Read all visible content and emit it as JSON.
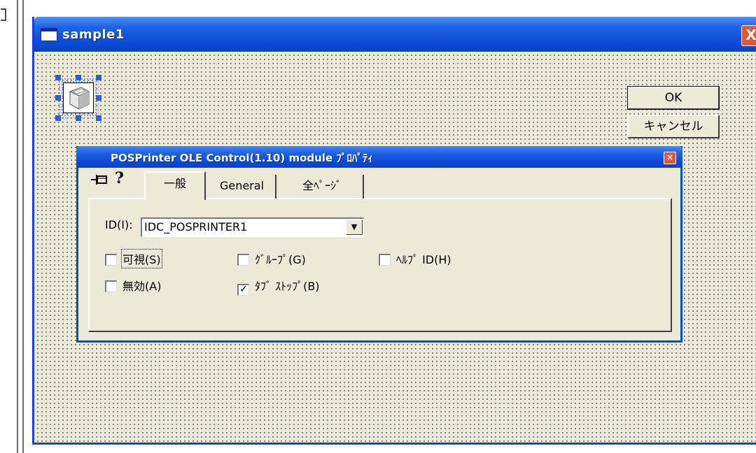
{
  "form": {
    "title": "sample1",
    "ok_label": "OK",
    "cancel_label": "キャンセル",
    "close_glyph": "X"
  },
  "dialog": {
    "title": "POSPrinter OLE Control(1.10) module ﾌﾟﾛﾊﾟﾃｨ",
    "close_glyph": "×",
    "help_glyph": "?",
    "tabs": [
      {
        "label": "一般",
        "active": true
      },
      {
        "label": "General",
        "active": false
      },
      {
        "label": "全ﾍﾟｰｼﾞ",
        "active": false
      }
    ],
    "id_label": "ID(I):",
    "id_value": "IDC_POSPRINTER1",
    "checkboxes": {
      "visible": {
        "label": "可視(S)",
        "checked": false
      },
      "group": {
        "label": "ｸﾞﾙｰﾌﾟ(G)",
        "checked": false
      },
      "helpid": {
        "label": "ﾍﾙﾌﾟ ID(H)",
        "checked": false
      },
      "disabled": {
        "label": "無効(A)",
        "checked": false
      },
      "tabstop": {
        "label": "ﾀﾌﾞ ｽﾄｯﾌﾟ(B)",
        "checked": true
      }
    }
  },
  "colors": {
    "titlebar": "#0a48d8",
    "face": "#ece9d8",
    "close": "#e0573a"
  },
  "icons": [
    "window-icon",
    "printer-icon",
    "pin-icon",
    "help-icon",
    "close-icon",
    "dropdown-arrow-icon",
    "checkmark-icon"
  ]
}
